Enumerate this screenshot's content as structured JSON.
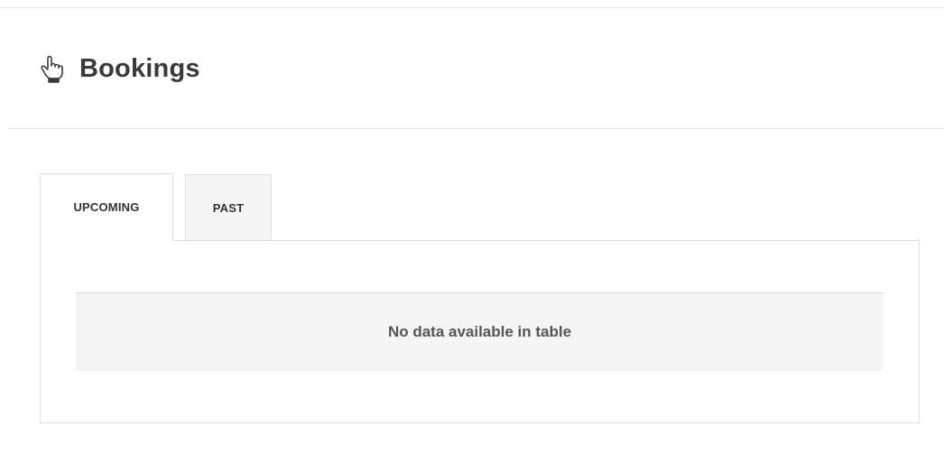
{
  "header": {
    "icon": "hand-pointing-icon",
    "title": "Bookings"
  },
  "tabs": [
    {
      "label": "UPCOMING",
      "active": true
    },
    {
      "label": "PAST",
      "active": false
    }
  ],
  "table": {
    "empty_message": "No data available in table"
  }
}
